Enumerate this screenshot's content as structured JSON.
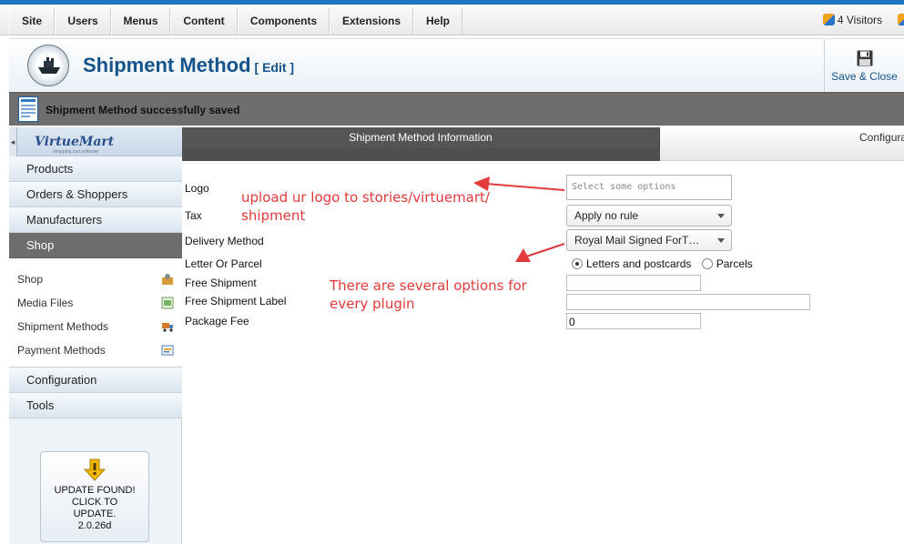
{
  "menu": [
    "Site",
    "Users",
    "Menus",
    "Content",
    "Components",
    "Extensions",
    "Help"
  ],
  "visitors": "4 Visitors",
  "header": {
    "title": "Shipment Method",
    "edit": "[ Edit ]",
    "save_close": "Save & Close"
  },
  "notice": "Shipment Method successfully saved",
  "sidebar": {
    "brand": "VirtueMart",
    "brand_sub": "shopping cart software",
    "categories_top": [
      "Products",
      "Orders & Shoppers",
      "Manufacturers",
      "Shop"
    ],
    "shop_items": [
      "Shop",
      "Media Files",
      "Shipment Methods",
      "Payment Methods"
    ],
    "categories_bottom": [
      "Configuration",
      "Tools"
    ],
    "update": [
      "UPDATE FOUND!",
      "CLICK TO",
      "UPDATE.",
      "2.0.26d"
    ]
  },
  "tabs": {
    "info": "Shipment Method Information",
    "config": "Configuration"
  },
  "form": {
    "logo_label": "Logo",
    "logo_placeholder": "Select some options",
    "tax_label": "Tax",
    "tax_value": "Apply no rule",
    "delivery_label": "Delivery Method",
    "delivery_value": "Royal Mail Signed ForT…",
    "letter_label": "Letter Or Parcel",
    "radio_letters": "Letters and postcards",
    "radio_parcels": "Parcels",
    "free_shipment_label": "Free Shipment",
    "free_shipment_value": "",
    "free_label_label": "Free Shipment Label",
    "free_label_value": "",
    "package_fee_label": "Package Fee",
    "package_fee_value": "0"
  },
  "annotations": {
    "logo_note_1": "upload ur logo to stories/virtuemart/",
    "logo_note_2": "shipment",
    "options_note_1": "There are several options for",
    "options_note_2": "every plugin"
  },
  "colors": {
    "accent": "#1d76c0",
    "title": "#14538b",
    "annotation": "#e23a3a",
    "dark_bar": "#6e6e6e"
  }
}
